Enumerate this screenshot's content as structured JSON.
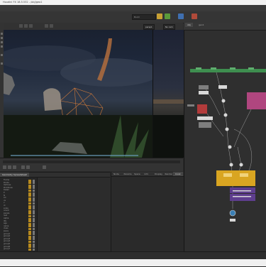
{
  "window": {
    "title": "Houdini FX 18.5.532 - /obj/geo1"
  },
  "shelf": {
    "context_label": "Build",
    "desktop_label": "Build",
    "accent_colors": [
      "#c8a033",
      "#5a9a3a",
      "#3f6fb0",
      "#b04a3a"
    ]
  },
  "viewport": {
    "camera_label": "persp1",
    "display_label": "No cam",
    "side_label": "View"
  },
  "network": {
    "tabs": [
      "obj",
      "geo1"
    ],
    "path": "/obj/geo1",
    "node_colors": {
      "green": "#3e8e4f",
      "pink": "#b0467f",
      "red": "#b23b3b",
      "yellow": "#d9a521",
      "purple": "#5e3e8e",
      "blue": "#3a7fb5",
      "grey": "#7e7e7e",
      "white": "#d8d8d8"
    }
  },
  "spreadsheet": {
    "tabs": [
      "Geometry Spreadsheet"
    ],
    "rows": [
      "Frame",
      "Points",
      "Vertices",
      "Primitives",
      "Detail",
      "P",
      "N",
      "Cd",
      "uv",
      "v",
      "id",
      "scale",
      "orient",
      "pscale",
      "rest",
      "Alpha",
      "life",
      "age",
      "name",
      "class",
      "piece",
      "group1",
      "group2",
      "group3",
      "group4",
      "group5",
      "group6",
      "group7"
    ]
  },
  "parameter_tabs": [
    "Node",
    "Params",
    "Spare",
    "Info",
    "Display",
    "Render",
    "Cook"
  ],
  "timeline": {
    "frame": "1",
    "range_end": "240"
  }
}
